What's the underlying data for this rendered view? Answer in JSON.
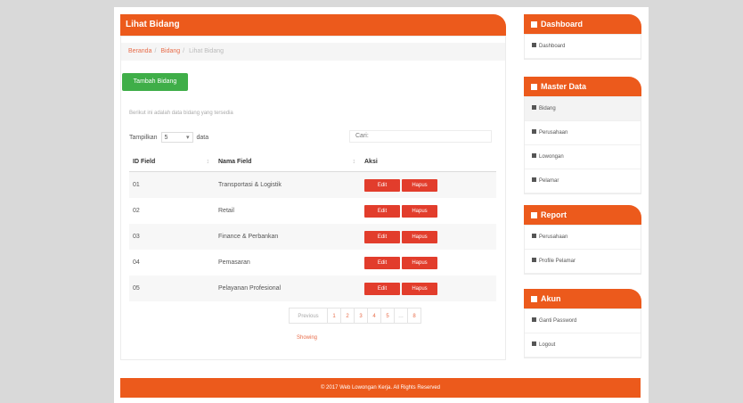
{
  "main": {
    "title": "Lihat Bidang",
    "breadcrumb": [
      "Beranda",
      "Bidang",
      "Lihat Bidang"
    ],
    "add_button": "Tambah Bidang",
    "hint": "Berikut ini adalah data bidang yang tersedia",
    "length_label": "Tampilkan",
    "length_value": "5",
    "length_suffix": "data",
    "search_label": "Cari:",
    "table": {
      "headers": [
        "ID Field",
        "Nama Field",
        "Aksi"
      ],
      "rows": [
        {
          "id": "01",
          "name": "Transportasi & Logistik"
        },
        {
          "id": "02",
          "name": "Retail"
        },
        {
          "id": "03",
          "name": "Finance & Perbankan"
        },
        {
          "id": "04",
          "name": "Pemasaran"
        },
        {
          "id": "05",
          "name": "Pelayanan Profesional"
        }
      ],
      "edit_label": "Edit",
      "delete_label": "Hapus"
    },
    "pagination": {
      "prev": "Previous",
      "pages": [
        "1",
        "2",
        "3",
        "4",
        "5"
      ],
      "dots": "…",
      "next": "8",
      "info": "Showing"
    }
  },
  "sidebar": {
    "dashboard": {
      "title": "Dashboard",
      "items": [
        "Dashboard"
      ]
    },
    "master": {
      "title": "Master Data",
      "items": [
        "Bidang",
        "Perusahaan",
        "Lowongan",
        "Pelamar"
      ]
    },
    "report": {
      "title": "Report",
      "items": [
        "Perusahaan",
        "Profile Pelamar"
      ]
    },
    "account": {
      "title": "Akun",
      "items": [
        "Ganti Password",
        "Logout"
      ]
    }
  },
  "footer": {
    "text": "© 2017 Web Lowongan Kerja. All Rights Reserved"
  },
  "colors": {
    "accent": "#ec5a1c",
    "success": "#3fae48",
    "danger": "#e23d2c"
  }
}
